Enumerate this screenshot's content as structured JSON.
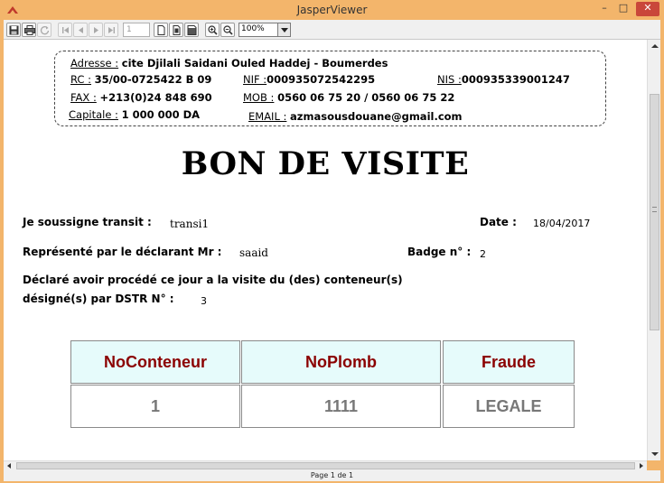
{
  "window": {
    "title": "JasperViewer",
    "minimize": "–",
    "maximize": "□",
    "close": "✕"
  },
  "toolbar": {
    "page_number": "1",
    "zoom_value": "100%"
  },
  "header": {
    "address_label": "Adresse :",
    "address_value": "cite Djilali Saidani Ouled Haddej - Boumerdes",
    "rc_label": "RC :",
    "rc_value": "35/00-0725422 B 09",
    "nif_label": "NIF :",
    "nif_value": "000935072542295",
    "nis_label": "NIS :",
    "nis_value": "000935339001247",
    "fax_label": "FAX :",
    "fax_value": "+213(0)24 848 690",
    "mob_label": "MOB :",
    "mob_value": "0560 06 75 20 / 0560 06 75 22",
    "capital_label": "Capitale :",
    "capital_value": "1 000 000 DA",
    "email_label": "EMAIL :",
    "email_value": "azmasousdouane@gmail.com"
  },
  "document": {
    "title": "BON DE VISITE",
    "transit_label": "Je soussigne transit :",
    "transit_value": "transi1",
    "date_label": "Date :",
    "date_value": "18/04/2017",
    "declarant_label": "Représenté par le déclarant Mr :",
    "declarant_value": "saaid",
    "badge_label": "Badge n° :",
    "badge_value": "2",
    "declared_line1": "Déclaré avoir procédé ce jour a la visite du (des) conteneur(s)",
    "declared_line2": "désigné(s) par DSTR N° :",
    "dstr_value": "3"
  },
  "table": {
    "columns": [
      "NoConteneur",
      "NoPlomb",
      "Fraude"
    ],
    "rows": [
      [
        "1",
        "1111",
        "LEGALE"
      ]
    ]
  },
  "status": {
    "page_info": "Page 1 de 1"
  }
}
